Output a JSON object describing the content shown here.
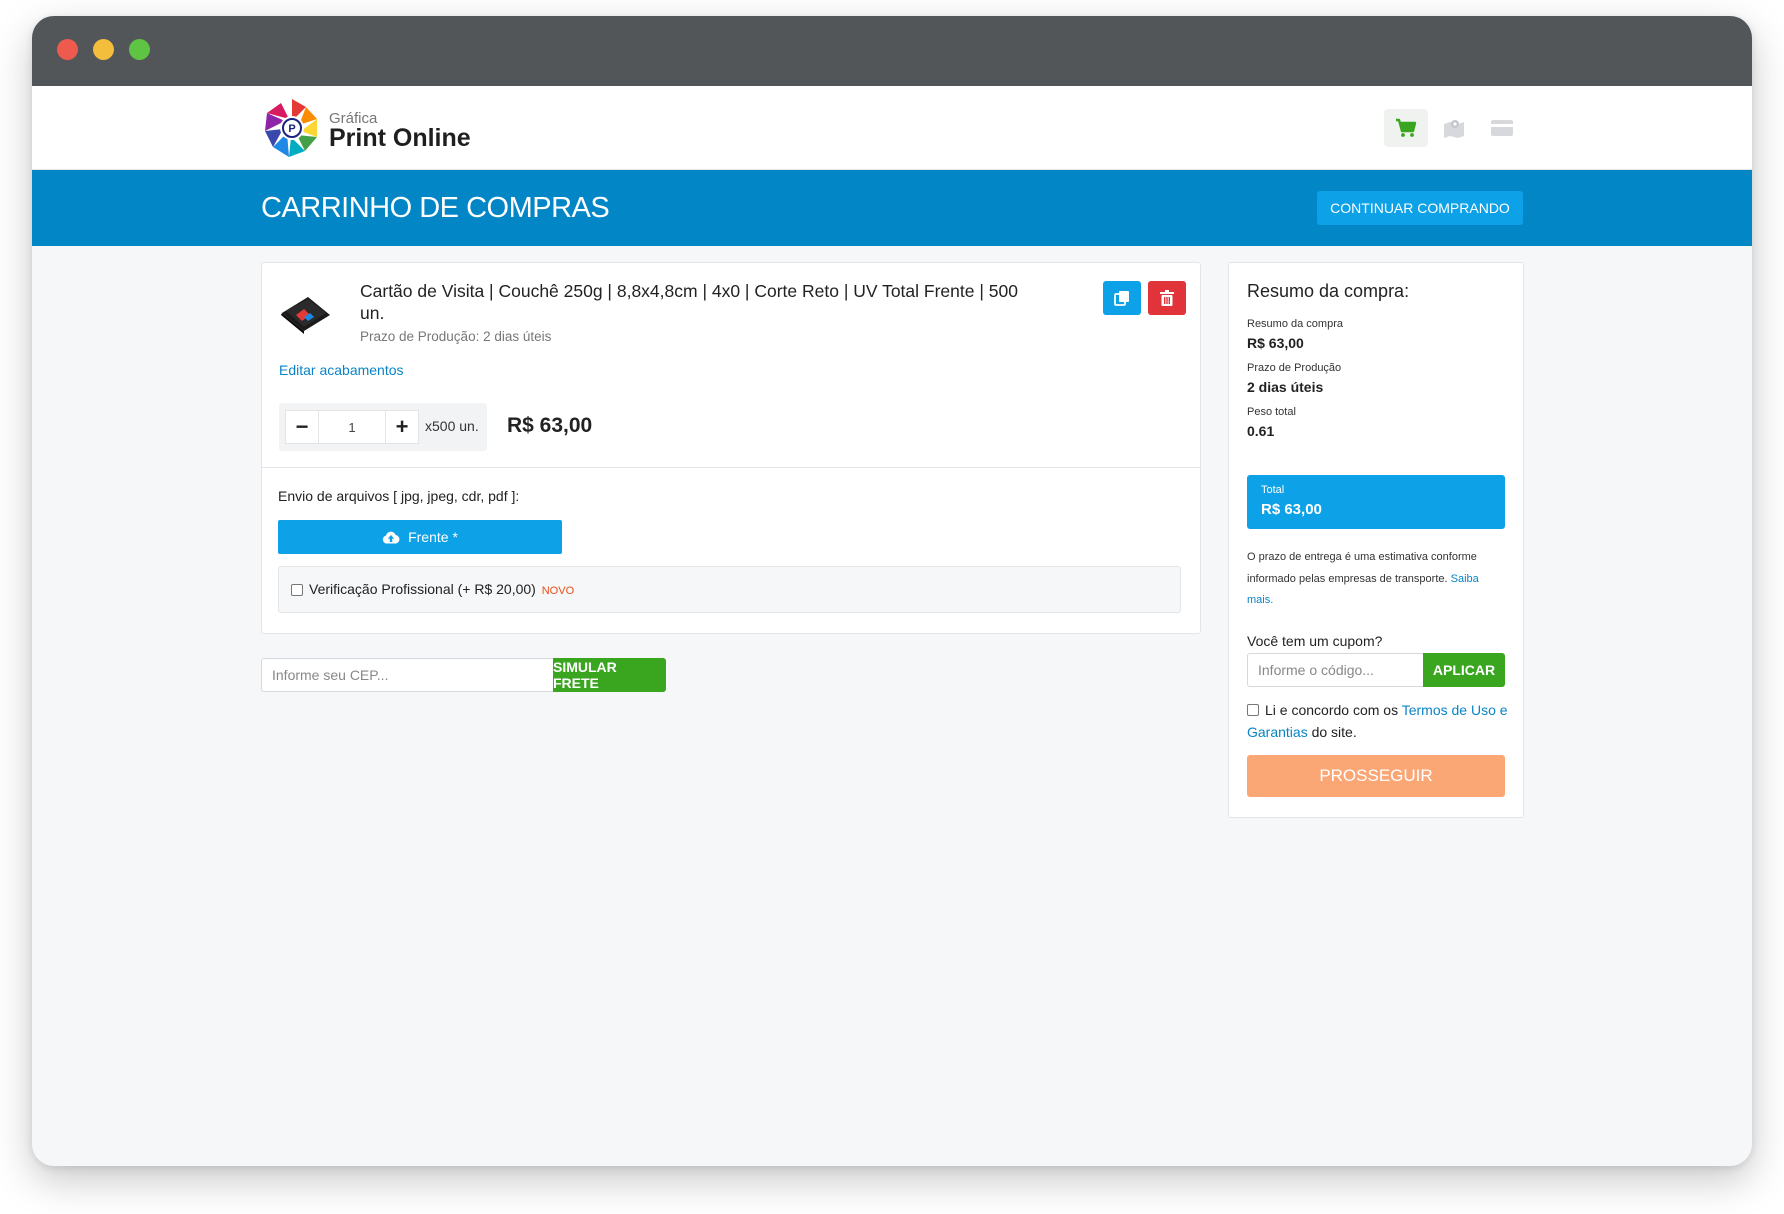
{
  "brand": {
    "small": "Gráfica",
    "name": "Print Online"
  },
  "nav": {
    "icons": [
      "cart-icon",
      "map-icon",
      "credit-card-icon"
    ],
    "active_color": "#3aa61f"
  },
  "banner": {
    "title": "CARRINHO DE COMPRAS",
    "continue_label": "CONTINUAR COMPRANDO"
  },
  "item": {
    "title": "Cartão de Visita | Couchê 250g | 8,8x4,8cm | 4x0 | Corte Reto | UV Total Frente | 500 un.",
    "production_time": "Prazo de Produção: 2 dias úteis",
    "edit_label": "Editar acabamentos",
    "quantity": "1",
    "unit_label": "x500 un.",
    "price": "R$ 63,00",
    "minus_label": "−",
    "plus_label": "+"
  },
  "upload": {
    "label": "Envio de arquivos [ jpg, jpeg, cdr, pdf ]:",
    "button_label": "Frente *"
  },
  "verification": {
    "label": "Verificação Profissional (+ R$ 20,00)",
    "badge": "NOVO",
    "checked": false
  },
  "shipping": {
    "placeholder": "Informe seu CEP...",
    "button_label": "SIMULAR FRETE"
  },
  "summary": {
    "title": "Resumo da compra:",
    "subtotal_label": "Resumo da compra",
    "subtotal_value": "R$ 63,00",
    "production_label": "Prazo de Produção",
    "production_value": "2 dias úteis",
    "weight_label": "Peso total",
    "weight_value": "0.61",
    "total_label": "Total",
    "total_value": "R$ 63,00",
    "note": "O prazo de entrega é uma estimativa conforme informado pelas empresas de transporte.",
    "note_link": "Saiba mais.",
    "coupon_label": "Você tem um cupom?",
    "coupon_placeholder": "Informe o código...",
    "coupon_button": "APLICAR",
    "terms_prefix": "Li e concordo com os",
    "terms_link": "Termos de Uso e Garantias",
    "terms_suffix": "do site.",
    "proceed_label": "PROSSEGUIR"
  },
  "colors": {
    "banner": "#0286c6",
    "primary_button": "#0da1e8",
    "success": "#3aa61f",
    "danger": "#e0333a",
    "proceed": "#fba775"
  }
}
